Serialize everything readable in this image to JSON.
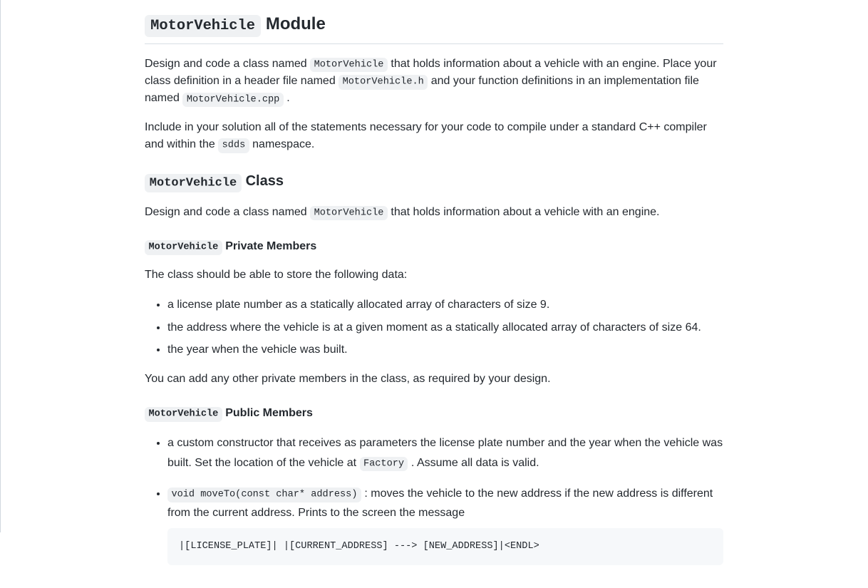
{
  "h2": {
    "code": "MotorVehicle",
    "rest": " Module"
  },
  "p1": {
    "t1": "Design and code a class named ",
    "c1": "MotorVehicle",
    "t2": " that holds information about a vehicle with an engine. Place your class definition in a header file named ",
    "c2": "MotorVehicle.h",
    "t3": " and your function definitions in an implementation file named ",
    "c3": "MotorVehicle.cpp",
    "t4": " ."
  },
  "p2": {
    "t1": "Include in your solution all of the statements necessary for your code to compile under a standard C++ compiler and within the ",
    "c1": "sdds",
    "t2": " namespace."
  },
  "h3": {
    "code": "MotorVehicle",
    "rest": " Class"
  },
  "p3": {
    "t1": "Design and code a class named ",
    "c1": "MotorVehicle",
    "t2": " that holds information about a vehicle with an engine."
  },
  "h4a": {
    "code": "MotorVehicle",
    "rest": " Private Members"
  },
  "p4": "The class should be able to store the following data:",
  "priv": {
    "li1": "a license plate number as a statically allocated array of characters of size 9.",
    "li2": "the address where the vehicle is at a given moment as a statically allocated array of characters of size 64.",
    "li3": "the year when the vehicle was built."
  },
  "p5": "You can add any other private members in the class, as required by your design.",
  "h4b": {
    "code": "MotorVehicle",
    "rest": " Public Members"
  },
  "pub": {
    "li1": {
      "t1": "a custom constructor that receives as parameters the license plate number and the year when the vehicle was built. Set the location of the vehicle at ",
      "c1": "Factory",
      "t2": " . Assume all data is valid."
    },
    "li2": {
      "c1": "void moveTo(const char* address)",
      "t1": " : moves the vehicle to the new address if the new address is different from the current address. Prints to the screen the message"
    }
  },
  "codeblock": "|[LICENSE_PLATE]| |[CURRENT_ADDRESS] ---> [NEW_ADDRESS]|<ENDL>"
}
